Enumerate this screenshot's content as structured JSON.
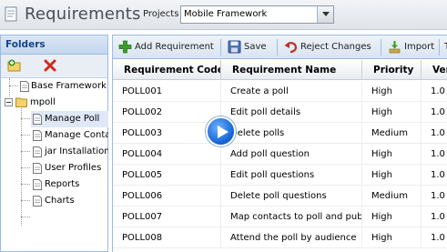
{
  "header": {
    "title": "Requirements",
    "project_label": "Projects",
    "project_value": "Mobile Framework"
  },
  "folders": {
    "title": "Folders",
    "tree": [
      {
        "label": "Base Framework",
        "type": "doc"
      },
      {
        "label": "mpoll",
        "type": "folder"
      },
      {
        "label": "Manage Poll",
        "type": "doc",
        "selected": true
      },
      {
        "label": "Manage Conta",
        "type": "doc"
      },
      {
        "label": "jar Installation",
        "type": "doc"
      },
      {
        "label": "User Profiles",
        "type": "doc"
      },
      {
        "label": "Reports",
        "type": "doc"
      },
      {
        "label": "Charts",
        "type": "doc"
      }
    ]
  },
  "toolbar": {
    "add_label": "Add Requirement",
    "save_label": "Save",
    "reject_label": "Reject Changes",
    "import_label": "Import",
    "more_label": "T"
  },
  "grid": {
    "columns": [
      "Requirement Code",
      "Requirement Name",
      "Priority",
      "Ver"
    ],
    "rows": [
      [
        "POLL001",
        "Create a poll",
        "High",
        "1.0"
      ],
      [
        "POLL002",
        "Edit poll details",
        "High",
        "1.0"
      ],
      [
        "POLL003",
        "Delete polls",
        "Medium",
        "1.0"
      ],
      [
        "POLL004",
        "Add poll question",
        "High",
        "1.0"
      ],
      [
        "POLL005",
        "Edit poll questions",
        "High",
        "1.0"
      ],
      [
        "POLL006",
        "Delete poll questions",
        "Medium",
        "1.0"
      ],
      [
        "POLL007",
        "Map contacts to poll and publis",
        "High",
        "1.0"
      ],
      [
        "POLL008",
        "Attend the poll by audience",
        "High",
        "1.0"
      ]
    ]
  }
}
